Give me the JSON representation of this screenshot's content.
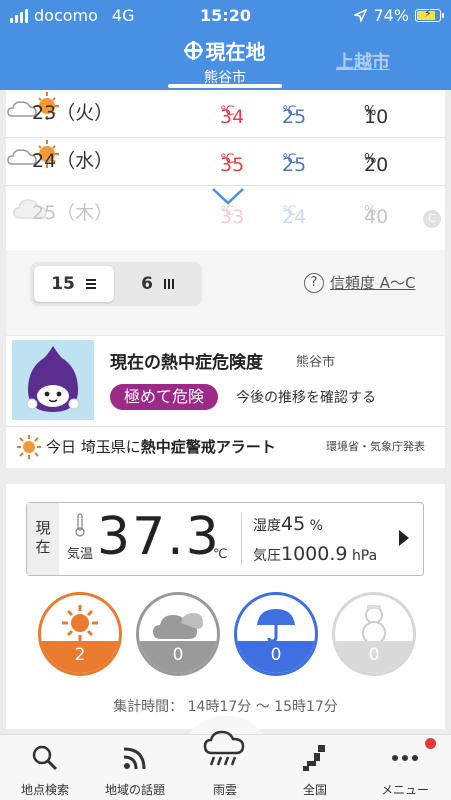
{
  "status_bar": {
    "carrier": "docomo",
    "network": "4G",
    "time": "15:20",
    "battery": "74%"
  },
  "header": {
    "current_tab": {
      "title": "現在地",
      "subtitle": "熊谷市"
    },
    "other_tab": "上越市"
  },
  "forecast": {
    "rows": [
      {
        "day": "23（火）",
        "icon": "cloud-sun-icon",
        "high": "34",
        "low": "25",
        "pop": "10"
      },
      {
        "day": "24（水）",
        "icon": "cloud-sun-icon",
        "high": "35",
        "low": "25",
        "pop": "20"
      },
      {
        "day": "25（木）",
        "icon": "cloud-icon",
        "high": "33",
        "low": "24",
        "pop": "40"
      }
    ],
    "unit_c": "℃",
    "unit_pct": "%",
    "toggle": {
      "option1": "15",
      "option2": "6"
    },
    "reliability": "信頼度 A〜C",
    "scroll_badge": "C"
  },
  "heatstroke": {
    "title": "現在の熱中症危険度",
    "place": "熊谷市",
    "level": "極めて危険",
    "check": "今後の推移を確認する",
    "alert_prefix": "今日 埼玉県に",
    "alert_bold": "熱中症警戒アラート",
    "source": "環境省・気象庁発表"
  },
  "current": {
    "label": "現在",
    "temp_label": "気温",
    "temperature": "37.3",
    "temp_unit": "℃",
    "humidity_label": "湿度",
    "humidity": "45",
    "humidity_unit": "%",
    "pressure_label": "気圧",
    "pressure": "1000.9",
    "pressure_unit": "hPa",
    "counts": {
      "sun": "2",
      "cloud": "0",
      "rain": "0",
      "snow": "0"
    },
    "period": "集計時間： 14時17分 〜 15時17分"
  },
  "tabbar": {
    "search": "地点検索",
    "topics": "地域の話題",
    "rain": "雨雲",
    "nation": "全国",
    "menu": "メニュー"
  },
  "colors": {
    "header": "#4a90e2",
    "hot": "#e0444a",
    "cold": "#4f76b8",
    "danger": "#9c2a87"
  }
}
